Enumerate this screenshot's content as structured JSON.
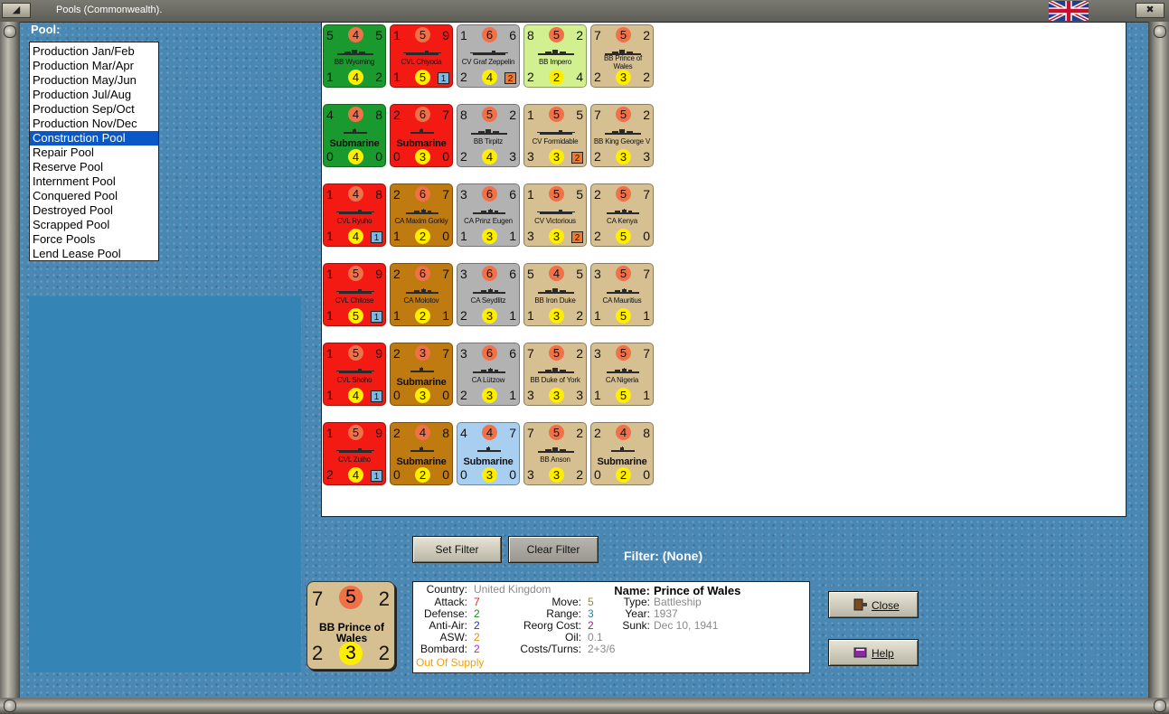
{
  "window": {
    "title": "Pools (Commonwealth)."
  },
  "pool": {
    "label": "Pool:",
    "items": [
      "Production Jan/Feb",
      "Production Mar/Apr",
      "Production May/Jun",
      "Production Jul/Aug",
      "Production Sep/Oct",
      "Production Nov/Dec",
      "Construction Pool",
      "Repair Pool",
      "Reserve Pool",
      "Internment Pool",
      "Conquered Pool",
      "Destroyed Pool",
      "Scrapped Pool",
      "Force Pools",
      "Lend Lease Pool"
    ],
    "selected": "Construction Pool"
  },
  "colors": {
    "green": "#1a9a2e",
    "red": "#f21a12",
    "gray": "#b2b2b2",
    "lime": "#d2f090",
    "tan": "#d6bf90",
    "brown": "#bf7a10",
    "lightblue": "#a8cff0",
    "ship": "#2a2a2a"
  },
  "counters": [
    [
      {
        "name": "BB Wyoming",
        "color": "green",
        "tl": "5",
        "tc": "4",
        "tr": "5",
        "bl": "1",
        "bc": "4",
        "br": "2",
        "icon": "battleship-icon"
      },
      {
        "name": "CVL Chiyoda",
        "color": "red",
        "tl": "1",
        "tc": "5",
        "tr": "9",
        "bl": "1",
        "bc": "5",
        "badge": "1",
        "badge_color": "blue",
        "icon": "carrier-icon"
      },
      {
        "name": "CV Graf Zeppelin",
        "color": "gray",
        "tl": "1",
        "tc": "6",
        "tr": "6",
        "bl": "2",
        "bc": "4",
        "badge": "2",
        "badge_color": "orange",
        "icon": "carrier-icon"
      },
      {
        "name": "BB Impero",
        "color": "lime",
        "tl": "8",
        "tc": "5",
        "tr": "2",
        "bl": "2",
        "bc": "2",
        "br": "4",
        "icon": "battleship-icon"
      },
      {
        "name": "BB Prince of Wales",
        "color": "tan",
        "tl": "7",
        "tc": "5",
        "tr": "2",
        "bl": "2",
        "bc": "3",
        "br": "2",
        "icon": "battleship-icon"
      }
    ],
    [
      {
        "name": "Submarine",
        "color": "green",
        "tl": "4",
        "tc": "4",
        "tr": "8",
        "bl": "0",
        "bc": "4",
        "br": "0",
        "icon": "submarine-icon"
      },
      {
        "name": "Submarine",
        "color": "red",
        "tl": "2",
        "tc": "6",
        "tr": "7",
        "bl": "0",
        "bc": "3",
        "br": "0",
        "icon": "submarine-icon"
      },
      {
        "name": "BB Tirpitz",
        "color": "gray",
        "tl": "8",
        "tc": "5",
        "tr": "2",
        "bl": "2",
        "bc": "4",
        "br": "3",
        "icon": "battleship-icon"
      },
      {
        "name": "CV Formidable",
        "color": "tan",
        "tl": "1",
        "tc": "5",
        "tr": "5",
        "bl": "3",
        "bc": "3",
        "badge": "2",
        "badge_color": "orange",
        "icon": "carrier-icon"
      },
      {
        "name": "BB King George V",
        "color": "tan",
        "tl": "7",
        "tc": "5",
        "tr": "2",
        "bl": "2",
        "bc": "3",
        "br": "3",
        "icon": "battleship-icon"
      }
    ],
    [
      {
        "name": "CVL Ryuho",
        "color": "red",
        "tl": "1",
        "tc": "4",
        "tr": "8",
        "bl": "1",
        "bc": "4",
        "badge": "1",
        "badge_color": "blue",
        "icon": "carrier-icon"
      },
      {
        "name": "CA Maxim Gorkiy",
        "color": "brown",
        "tl": "2",
        "tc": "6",
        "tr": "7",
        "bl": "1",
        "bc": "2",
        "br": "0",
        "icon": "cruiser-icon"
      },
      {
        "name": "CA Prinz Eugen",
        "color": "gray",
        "tl": "3",
        "tc": "6",
        "tr": "6",
        "bl": "1",
        "bc": "3",
        "br": "1",
        "icon": "cruiser-icon"
      },
      {
        "name": "CV Victorious",
        "color": "tan",
        "tl": "1",
        "tc": "5",
        "tr": "5",
        "bl": "3",
        "bc": "3",
        "badge": "2",
        "badge_color": "orange",
        "icon": "carrier-icon"
      },
      {
        "name": "CA Kenya",
        "color": "tan",
        "tl": "2",
        "tc": "5",
        "tr": "7",
        "bl": "2",
        "bc": "5",
        "br": "0",
        "icon": "cruiser-icon"
      }
    ],
    [
      {
        "name": "CVL Chitose",
        "color": "red",
        "tl": "1",
        "tc": "5",
        "tr": "9",
        "bl": "1",
        "bc": "5",
        "badge": "1",
        "badge_color": "blue",
        "icon": "carrier-icon"
      },
      {
        "name": "CA Molotov",
        "color": "brown",
        "tl": "2",
        "tc": "6",
        "tr": "7",
        "bl": "1",
        "bc": "2",
        "br": "1",
        "icon": "cruiser-icon"
      },
      {
        "name": "CA Seydlitz",
        "color": "gray",
        "tl": "3",
        "tc": "6",
        "tr": "6",
        "bl": "2",
        "bc": "3",
        "br": "1",
        "icon": "cruiser-icon"
      },
      {
        "name": "BB Iron Duke",
        "color": "tan",
        "tl": "5",
        "tc": "4",
        "tr": "5",
        "bl": "1",
        "bc": "3",
        "br": "2",
        "icon": "battleship-icon"
      },
      {
        "name": "CA Mauritius",
        "color": "tan",
        "tl": "3",
        "tc": "5",
        "tr": "7",
        "bl": "1",
        "bc": "5",
        "br": "1",
        "icon": "cruiser-icon"
      }
    ],
    [
      {
        "name": "CVL Shoho",
        "color": "red",
        "tl": "1",
        "tc": "5",
        "tr": "9",
        "bl": "1",
        "bc": "4",
        "badge": "1",
        "badge_color": "blue",
        "icon": "carrier-icon"
      },
      {
        "name": "Submarine",
        "color": "brown",
        "tl": "2",
        "tc": "3",
        "tr": "7",
        "bl": "0",
        "bc": "3",
        "br": "0",
        "icon": "submarine-icon"
      },
      {
        "name": "CA Lützow",
        "color": "gray",
        "tl": "3",
        "tc": "6",
        "tr": "6",
        "bl": "2",
        "bc": "3",
        "br": "1",
        "icon": "cruiser-icon"
      },
      {
        "name": "BB Duke of York",
        "color": "tan",
        "tl": "7",
        "tc": "5",
        "tr": "2",
        "bl": "3",
        "bc": "3",
        "br": "3",
        "icon": "battleship-icon"
      },
      {
        "name": "CA Nigeria",
        "color": "tan",
        "tl": "3",
        "tc": "5",
        "tr": "7",
        "bl": "1",
        "bc": "5",
        "br": "1",
        "icon": "cruiser-icon"
      }
    ],
    [
      {
        "name": "CVL Zuiho",
        "color": "red",
        "tl": "1",
        "tc": "5",
        "tr": "9",
        "bl": "2",
        "bc": "4",
        "badge": "1",
        "badge_color": "blue",
        "icon": "carrier-icon"
      },
      {
        "name": "Submarine",
        "color": "brown",
        "tl": "2",
        "tc": "4",
        "tr": "8",
        "bl": "0",
        "bc": "2",
        "br": "0",
        "icon": "submarine-icon"
      },
      {
        "name": "Submarine",
        "color": "lightblue",
        "tl": "4",
        "tc": "4",
        "tr": "7",
        "bl": "0",
        "bc": "3",
        "br": "0",
        "icon": "submarine-icon"
      },
      {
        "name": "BB Anson",
        "color": "tan",
        "tl": "7",
        "tc": "5",
        "tr": "2",
        "bl": "3",
        "bc": "3",
        "br": "2",
        "icon": "battleship-icon"
      },
      {
        "name": "Submarine",
        "color": "tan",
        "tl": "2",
        "tc": "4",
        "tr": "8",
        "bl": "0",
        "bc": "2",
        "br": "0",
        "icon": "submarine-icon"
      }
    ]
  ],
  "filter": {
    "set_label": "Set Filter",
    "clear_label": "Clear Filter",
    "status": "Filter:  (None)"
  },
  "selected_unit": {
    "counter": {
      "tl": "7",
      "tc": "5",
      "tr": "2",
      "bl": "2",
      "bc": "3",
      "br": "2",
      "name": "BB Prince of Wales"
    },
    "country_label": "Country:",
    "country": "United Kingdom",
    "attack_label": "Attack:",
    "attack": "7",
    "defense_label": "Defense:",
    "defense": "2",
    "antiair_label": "Anti-Air:",
    "antiair": "2",
    "asw_label": "ASW:",
    "asw": "2",
    "bombard_label": "Bombard:",
    "bombard": "2",
    "supply": "Out Of Supply",
    "move_label": "Move:",
    "move": "5",
    "range_label": "Range:",
    "range": "3",
    "reorg_label": "Reorg Cost:",
    "reorg": "2",
    "oil_label": "Oil:",
    "oil": "0.1",
    "costs_label": "Costs/Turns:",
    "costs": "2+3/6",
    "name_label": "Name:",
    "name": "Prince of Wales",
    "type_label": "Type:",
    "type": "Battleship",
    "year_label": "Year:",
    "year": "1937",
    "sunk_label": "Sunk:",
    "sunk": "Dec 10, 1941"
  },
  "actions": {
    "close_label": "Close",
    "help_label": "Help"
  }
}
